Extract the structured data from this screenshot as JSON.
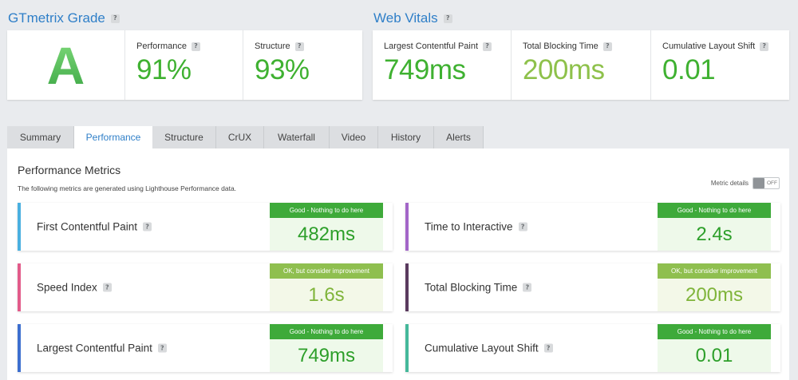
{
  "gtmetrix": {
    "title": "GTmetrix Grade",
    "grade": "A",
    "performance": {
      "label": "Performance",
      "value": "91%"
    },
    "structure": {
      "label": "Structure",
      "value": "93%"
    }
  },
  "web_vitals": {
    "title": "Web Vitals",
    "lcp": {
      "label": "Largest Contentful Paint",
      "value": "749ms",
      "color": "#3fb131"
    },
    "tbt": {
      "label": "Total Blocking Time",
      "value": "200ms",
      "color": "#8ec14b"
    },
    "cls": {
      "label": "Cumulative Layout Shift",
      "value": "0.01",
      "color": "#3fb131"
    }
  },
  "tabs": [
    {
      "label": "Summary"
    },
    {
      "label": "Performance"
    },
    {
      "label": "Structure"
    },
    {
      "label": "CrUX"
    },
    {
      "label": "Waterfall"
    },
    {
      "label": "Video"
    },
    {
      "label": "History"
    },
    {
      "label": "Alerts"
    }
  ],
  "active_tab": "Performance",
  "panel": {
    "title": "Performance Metrics",
    "description": "The following metrics are generated using Lighthouse Performance data.",
    "metric_details_label": "Metric details",
    "toggle_state": "OFF"
  },
  "metrics": [
    {
      "name": "First Contentful Paint",
      "badge": "Good - Nothing to do here",
      "value": "482ms",
      "accent": "#4ab0e0",
      "badge_color": "#3eaa3a",
      "bg": "#eef9ea",
      "text_color": "#2d9f2a"
    },
    {
      "name": "Time to Interactive",
      "badge": "Good - Nothing to do here",
      "value": "2.4s",
      "accent": "#a366c8",
      "badge_color": "#3eaa3a",
      "bg": "#eef9ea",
      "text_color": "#2d9f2a"
    },
    {
      "name": "Speed Index",
      "badge": "OK, but consider improvement",
      "value": "1.6s",
      "accent": "#e25b8a",
      "badge_color": "#8fbf4f",
      "bg": "#f3f8e8",
      "text_color": "#7fb43a"
    },
    {
      "name": "Total Blocking Time",
      "badge": "OK, but consider improvement",
      "value": "200ms",
      "accent": "#5a3a5e",
      "badge_color": "#8fbf4f",
      "bg": "#f3f8e8",
      "text_color": "#7fb43a"
    },
    {
      "name": "Largest Contentful Paint",
      "badge": "Good - Nothing to do here",
      "value": "749ms",
      "accent": "#3d6fcf",
      "badge_color": "#3eaa3a",
      "bg": "#eef9ea",
      "text_color": "#2d9f2a"
    },
    {
      "name": "Cumulative Layout Shift",
      "badge": "Good - Nothing to do here",
      "value": "0.01",
      "accent": "#45b89a",
      "badge_color": "#3eaa3a",
      "bg": "#eef9ea",
      "text_color": "#2d9f2a"
    }
  ]
}
